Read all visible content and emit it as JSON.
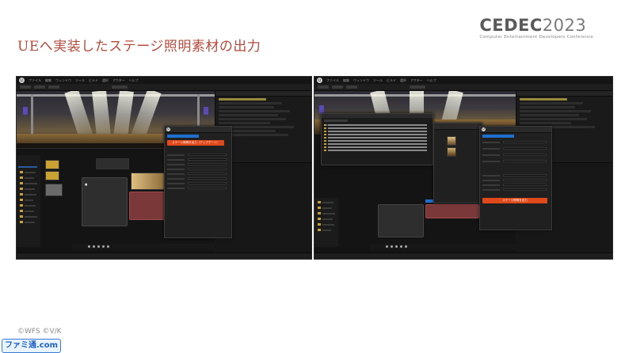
{
  "slide": {
    "title": "UEへ実装したステージ照明素材の出力",
    "credits": "©WFS ©V/K",
    "accent_color": "#b34b3e"
  },
  "logo": {
    "brand": "CEDEC",
    "year": "2023",
    "subtitle": "Computer Entertainment Developers Conference"
  },
  "watermark": {
    "text": "ファミ通.com"
  },
  "screenshots": [
    {
      "app": "Unreal Engine Editor",
      "menu": [
        "ファイル",
        "編集",
        "ウィンドウ",
        "ツール",
        "ビルド",
        "選択",
        "アクター",
        "ヘルプ"
      ],
      "tool_panel": {
        "export_button_label": "ステージ照明を出力（アップデート）",
        "accent": "#e04a1a"
      }
    },
    {
      "app": "Unreal Engine Editor",
      "menu": [
        "ファイル",
        "編集",
        "ウィンドウ",
        "ツール",
        "ビルド",
        "選択",
        "アクター",
        "ヘルプ"
      ],
      "tool_panel": {
        "export_button_label": "ステージ照明を出力",
        "accent": "#e04a1a"
      }
    }
  ]
}
